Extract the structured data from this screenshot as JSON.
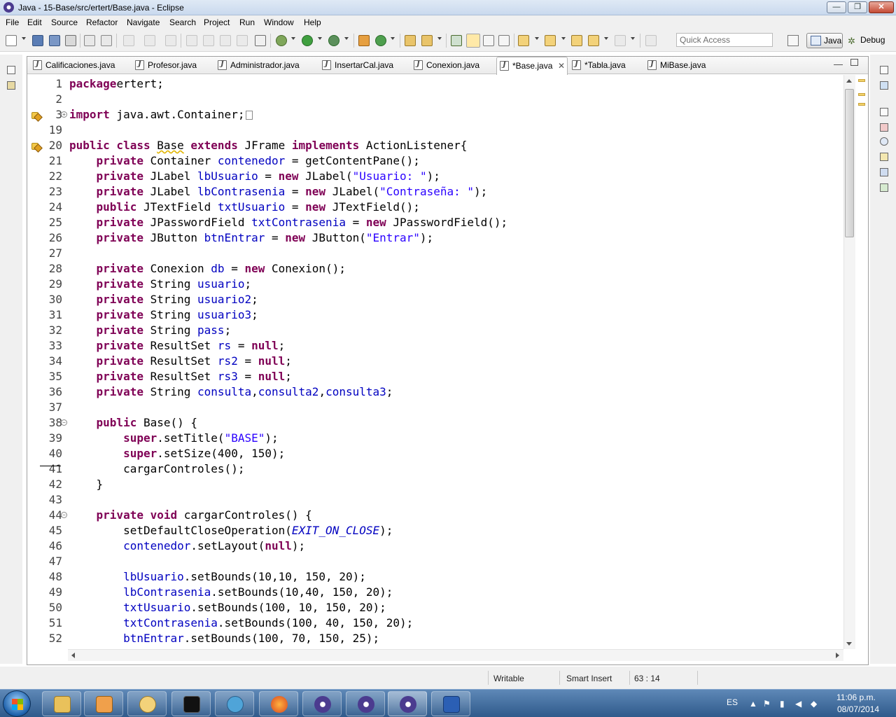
{
  "window": {
    "title": "Java - 15-Base/src/ertert/Base.java - Eclipse",
    "min_label": "—",
    "max_label": "❐",
    "close_label": "✕"
  },
  "menu": [
    "File",
    "Edit",
    "Source",
    "Refactor",
    "Navigate",
    "Search",
    "Project",
    "Run",
    "Window",
    "Help"
  ],
  "toolbar": {
    "quick_access_placeholder": "Quick Access",
    "perspective_java": "Java",
    "perspective_debug": "Debug"
  },
  "tabs": [
    {
      "label": "Calificaciones.java",
      "active": false
    },
    {
      "label": "Profesor.java",
      "active": false
    },
    {
      "label": "Administrador.java",
      "active": false
    },
    {
      "label": "InsertarCal.java",
      "active": false
    },
    {
      "label": "Conexion.java",
      "active": false
    },
    {
      "label": "*Base.java",
      "active": true,
      "close": "✕"
    },
    {
      "label": "*Tabla.java",
      "active": false
    },
    {
      "label": "MiBase.java",
      "active": false
    }
  ],
  "editor": {
    "line_numbers": [
      "1",
      "2",
      "3",
      "19",
      "20",
      "21",
      "22",
      "23",
      "24",
      "25",
      "26",
      "27",
      "28",
      "29",
      "30",
      "31",
      "32",
      "33",
      "34",
      "35",
      "36",
      "37",
      "38",
      "39",
      "40",
      "41",
      "42",
      "43",
      "44",
      "45",
      "46",
      "47",
      "48",
      "49",
      "50",
      "51",
      "52"
    ],
    "code": [
      {
        "n": "1",
        "tokens": [
          [
            "kw",
            "package"
          ],
          [
            "",
            "ertert;"
          ]
        ]
      },
      {
        "n": "2",
        "tokens": []
      },
      {
        "n": "3",
        "tokens": [
          [
            "kw",
            "import"
          ],
          [
            "",
            " java.awt.Container;"
          ]
        ]
      },
      {
        "n": "19",
        "tokens": []
      },
      {
        "n": "20",
        "tokens": [
          [
            "kw",
            "public class "
          ],
          [
            "warn",
            "Base"
          ],
          [
            "kw",
            " extends "
          ],
          [
            "",
            "JFrame "
          ],
          [
            "kw",
            "implements "
          ],
          [
            "",
            "ActionListener{"
          ]
        ]
      },
      {
        "n": "21",
        "tokens": [
          [
            "",
            "    "
          ],
          [
            "kw",
            "private "
          ],
          [
            "",
            "Container "
          ],
          [
            "fld",
            "contenedor"
          ],
          [
            "",
            " = getContentPane();"
          ]
        ]
      },
      {
        "n": "22",
        "tokens": [
          [
            "",
            "    "
          ],
          [
            "kw",
            "private "
          ],
          [
            "",
            "JLabel "
          ],
          [
            "fld",
            "lbUsuario"
          ],
          [
            "",
            " = "
          ],
          [
            "kw",
            "new "
          ],
          [
            "",
            "JLabel("
          ],
          [
            "str",
            "\"Usuario: \""
          ],
          [
            "",
            ");"
          ]
        ]
      },
      {
        "n": "23",
        "tokens": [
          [
            "",
            "    "
          ],
          [
            "kw",
            "private "
          ],
          [
            "",
            "JLabel "
          ],
          [
            "fld",
            "lbContrasenia"
          ],
          [
            "",
            " = "
          ],
          [
            "kw",
            "new "
          ],
          [
            "",
            "JLabel("
          ],
          [
            "str",
            "\"Contraseña: \""
          ],
          [
            "",
            ");"
          ]
        ]
      },
      {
        "n": "24",
        "tokens": [
          [
            "",
            "    "
          ],
          [
            "kw",
            "public "
          ],
          [
            "",
            "JTextField "
          ],
          [
            "fld",
            "txtUsuario"
          ],
          [
            "",
            " = "
          ],
          [
            "kw",
            "new "
          ],
          [
            "",
            "JTextField();"
          ]
        ]
      },
      {
        "n": "25",
        "tokens": [
          [
            "",
            "    "
          ],
          [
            "kw",
            "private "
          ],
          [
            "",
            "JPasswordField "
          ],
          [
            "fld",
            "txtContrasenia"
          ],
          [
            "",
            " = "
          ],
          [
            "kw",
            "new "
          ],
          [
            "",
            "JPasswordField();"
          ]
        ]
      },
      {
        "n": "26",
        "tokens": [
          [
            "",
            "    "
          ],
          [
            "kw",
            "private "
          ],
          [
            "",
            "JButton "
          ],
          [
            "fld",
            "btnEntrar"
          ],
          [
            "",
            " = "
          ],
          [
            "kw",
            "new "
          ],
          [
            "",
            "JButton("
          ],
          [
            "str",
            "\"Entrar\""
          ],
          [
            "",
            ");"
          ]
        ]
      },
      {
        "n": "27",
        "tokens": []
      },
      {
        "n": "28",
        "tokens": [
          [
            "",
            "    "
          ],
          [
            "kw",
            "private "
          ],
          [
            "",
            "Conexion "
          ],
          [
            "fld",
            "db"
          ],
          [
            "",
            " = "
          ],
          [
            "kw",
            "new "
          ],
          [
            "",
            "Conexion();"
          ]
        ]
      },
      {
        "n": "29",
        "tokens": [
          [
            "",
            "    "
          ],
          [
            "kw",
            "private "
          ],
          [
            "",
            "String "
          ],
          [
            "fld",
            "usuario"
          ],
          [
            "",
            ";"
          ]
        ]
      },
      {
        "n": "30",
        "tokens": [
          [
            "",
            "    "
          ],
          [
            "kw",
            "private "
          ],
          [
            "",
            "String "
          ],
          [
            "fld",
            "usuario2"
          ],
          [
            "",
            ";"
          ]
        ]
      },
      {
        "n": "31",
        "tokens": [
          [
            "",
            "    "
          ],
          [
            "kw",
            "private "
          ],
          [
            "",
            "String "
          ],
          [
            "fld",
            "usuario3"
          ],
          [
            "",
            ";"
          ]
        ]
      },
      {
        "n": "32",
        "tokens": [
          [
            "",
            "    "
          ],
          [
            "kw",
            "private "
          ],
          [
            "",
            "String "
          ],
          [
            "fld",
            "pass"
          ],
          [
            "",
            ";"
          ]
        ]
      },
      {
        "n": "33",
        "tokens": [
          [
            "",
            "    "
          ],
          [
            "kw",
            "private "
          ],
          [
            "",
            "ResultSet "
          ],
          [
            "fld",
            "rs"
          ],
          [
            "",
            " = "
          ],
          [
            "kw",
            "null"
          ],
          [
            "",
            ";"
          ]
        ]
      },
      {
        "n": "34",
        "tokens": [
          [
            "",
            "    "
          ],
          [
            "kw",
            "private "
          ],
          [
            "",
            "ResultSet "
          ],
          [
            "fld",
            "rs2"
          ],
          [
            "",
            " = "
          ],
          [
            "kw",
            "null"
          ],
          [
            "",
            ";"
          ]
        ]
      },
      {
        "n": "35",
        "tokens": [
          [
            "",
            "    "
          ],
          [
            "kw",
            "private "
          ],
          [
            "",
            "ResultSet "
          ],
          [
            "fld",
            "rs3"
          ],
          [
            "",
            " = "
          ],
          [
            "kw",
            "null"
          ],
          [
            "",
            ";"
          ]
        ]
      },
      {
        "n": "36",
        "tokens": [
          [
            "",
            "    "
          ],
          [
            "kw",
            "private "
          ],
          [
            "",
            "String "
          ],
          [
            "fld",
            "consulta"
          ],
          [
            "",
            ","
          ],
          [
            "fld",
            "consulta2"
          ],
          [
            "",
            ","
          ],
          [
            "fld",
            "consulta3"
          ],
          [
            "",
            ";"
          ]
        ]
      },
      {
        "n": "37",
        "tokens": []
      },
      {
        "n": "38",
        "tokens": [
          [
            "",
            "    "
          ],
          [
            "kw",
            "public "
          ],
          [
            "",
            "Base() {"
          ]
        ]
      },
      {
        "n": "39",
        "tokens": [
          [
            "",
            "        "
          ],
          [
            "kw",
            "super"
          ],
          [
            "",
            ".setTitle("
          ],
          [
            "str",
            "\"BASE\""
          ],
          [
            "",
            ");"
          ]
        ]
      },
      {
        "n": "40",
        "tokens": [
          [
            "",
            "        "
          ],
          [
            "kw",
            "super"
          ],
          [
            "",
            ".setSize(400, 150);"
          ]
        ]
      },
      {
        "n": "41",
        "tokens": [
          [
            "",
            "        cargarControles();"
          ]
        ]
      },
      {
        "n": "42",
        "tokens": [
          [
            "",
            "    }"
          ]
        ]
      },
      {
        "n": "43",
        "tokens": []
      },
      {
        "n": "44",
        "tokens": [
          [
            "",
            "    "
          ],
          [
            "kw",
            "private void "
          ],
          [
            "",
            "cargarControles() {"
          ]
        ]
      },
      {
        "n": "45",
        "tokens": [
          [
            "",
            "        setDefaultCloseOperation("
          ],
          [
            "cst",
            "EXIT_ON_CLOSE"
          ],
          [
            "",
            ");"
          ]
        ]
      },
      {
        "n": "46",
        "tokens": [
          [
            "",
            "        "
          ],
          [
            "fld",
            "contenedor"
          ],
          [
            "",
            ".setLayout("
          ],
          [
            "kw",
            "null"
          ],
          [
            "",
            ");"
          ]
        ]
      },
      {
        "n": "47",
        "tokens": []
      },
      {
        "n": "48",
        "tokens": [
          [
            "",
            "        "
          ],
          [
            "fld",
            "lbUsuario"
          ],
          [
            "",
            ".setBounds(10,10, 150, 20);"
          ]
        ]
      },
      {
        "n": "49",
        "tokens": [
          [
            "",
            "        "
          ],
          [
            "fld",
            "lbContrasenia"
          ],
          [
            "",
            ".setBounds(10,40, 150, 20);"
          ]
        ]
      },
      {
        "n": "50",
        "tokens": [
          [
            "",
            "        "
          ],
          [
            "fld",
            "txtUsuario"
          ],
          [
            "",
            ".setBounds(100, 10, 150, 20);"
          ]
        ]
      },
      {
        "n": "51",
        "tokens": [
          [
            "",
            "        "
          ],
          [
            "fld",
            "txtContrasenia"
          ],
          [
            "",
            ".setBounds(100, 40, 150, 20);"
          ]
        ]
      },
      {
        "n": "52",
        "tokens": [
          [
            "",
            "        "
          ],
          [
            "fld",
            "btnEntrar"
          ],
          [
            "",
            ".setBounds(100, 70, 150, 25);"
          ]
        ]
      }
    ]
  },
  "statusbar": {
    "writable": "Writable",
    "insert_mode": "Smart Insert",
    "position": "63 : 14"
  },
  "taskbar": {
    "lang": "ES",
    "time": "11:06 p.m.",
    "date": "08/07/2014"
  },
  "colors": {
    "keyword": "#7f0055",
    "field": "#0000c0",
    "string": "#2a00ff"
  }
}
